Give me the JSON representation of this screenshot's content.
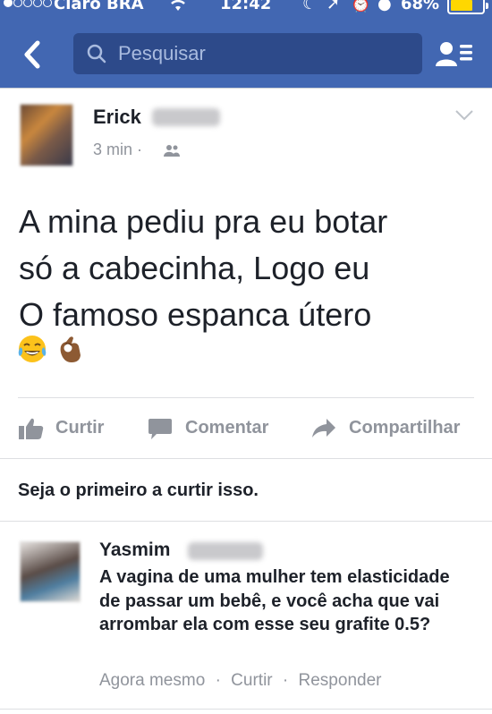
{
  "status_bar": {
    "carrier": "Claro BRA",
    "time": "12:42",
    "battery": "68%",
    "battery_level": 0.68,
    "signal_bars_filled": 1,
    "signal_bars_total": 5,
    "icons": [
      "wifi-icon",
      "moon-icon",
      "location-icon",
      "alarm-icon",
      "rotation-lock-icon"
    ]
  },
  "header": {
    "back_icon": "chevron-left-icon",
    "search_placeholder": "Pesquisar",
    "friend_requests_icon": "friend-requests-icon",
    "background_color": "#4267b2"
  },
  "post": {
    "author_first_name": "Erick",
    "time": "3 min",
    "separator": "·",
    "audience_icon": "friends-icon",
    "text_lines": [
      "A mina pediu pra eu botar",
      "só a cabecinha, Logo eu",
      "O famoso espanca útero"
    ],
    "emojis": [
      "tears-of-joy-emoji",
      "ok-hand-emoji"
    ]
  },
  "actions": {
    "like": "Curtir",
    "comment": "Comentar",
    "share": "Compartilhar"
  },
  "likes_summary": "Seja o primeiro a curtir isso.",
  "comment": {
    "author_first_name": "Yasmim",
    "text": "A vagina de uma mulher tem elasticidade de passar um bebê, e você acha que vai arrombar ela com esse seu grafite 0.5?",
    "time": "Agora mesmo",
    "like": "Curtir",
    "reply": "Responder",
    "separator": "·"
  }
}
